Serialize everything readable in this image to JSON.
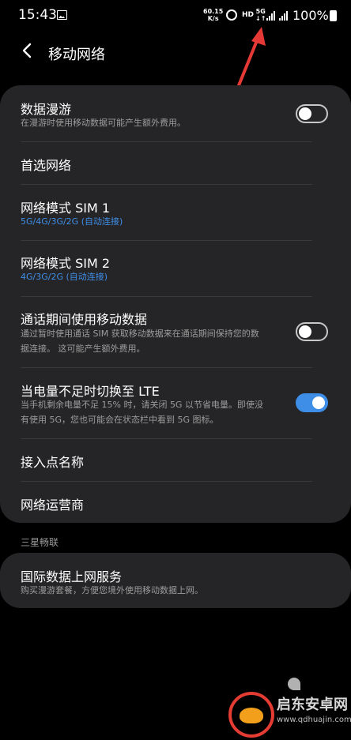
{
  "status_bar": {
    "time": "15:43",
    "net_speed_value": "60.15",
    "net_speed_unit": "K/s",
    "hd": "HD",
    "network_type": "5G",
    "battery": "100%"
  },
  "header": {
    "title": "移动网络"
  },
  "settings": [
    {
      "title": "数据漫游",
      "subtitle": "在漫游时使用移动数据可能产生额外费用。",
      "toggle": "off"
    },
    {
      "title": "首选网络"
    },
    {
      "title": "网络模式 SIM 1",
      "subtitle": "5G/4G/3G/2G (自动连接)"
    },
    {
      "title": "网络模式 SIM 2",
      "subtitle": "4G/3G/2G (自动连接)"
    },
    {
      "title": "通话期间使用移动数据",
      "subtitle_line1": "通过暂时使用通话 SIM 获取移动数据来在通话期间保持您的数",
      "subtitle_line2": "据连接。 这可能产生额外费用。",
      "toggle": "off"
    },
    {
      "title": "当电量不足时切换至 LTE",
      "subtitle_line1": "当手机剩余电量不足 15% 时，请关闭 5G 以节省电量。即使没",
      "subtitle_line2": "有使用 5G，您也可能会在状态栏中看到 5G 图标。",
      "toggle": "on"
    },
    {
      "title": "接入点名称"
    },
    {
      "title": "网络运营商"
    }
  ],
  "section_label": "三星畅联",
  "intl": {
    "title": "国际数据上网服务",
    "subtitle": "购买漫游套餐，方便您境外使用移动数据上网。"
  },
  "watermark": {
    "name": "启东安卓网",
    "url": "www.qdhuajin.com"
  },
  "colors": {
    "accent": "#3e8ee8",
    "card": "#252527",
    "background": "#000000",
    "annotation_arrow": "#e53935"
  }
}
